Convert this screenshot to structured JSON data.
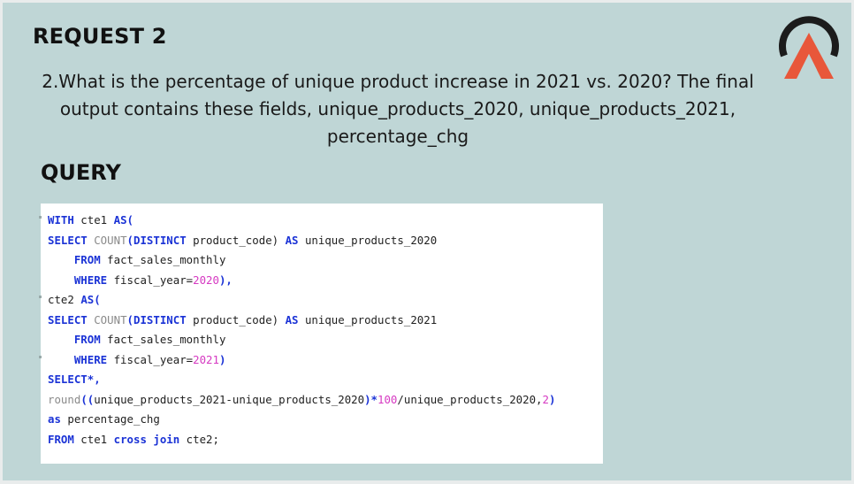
{
  "slide": {
    "title": "REQUEST 2",
    "question": "2.What is the percentage of unique product increase in 2021 vs. 2020? The final output contains these fields, unique_products_2020, unique_products_2021, percentage_chg",
    "query_heading": "QUERY",
    "logo_icon": "triangle-a-logo-icon",
    "colors": {
      "background": "#bfd6d6",
      "logo_dark": "#1c1c1c",
      "logo_accent": "#e8573a",
      "keyword": "#1b33d6",
      "number": "#d63ac2"
    }
  },
  "code": {
    "l1_kw1": "WITH",
    "l1_t1": " cte1 ",
    "l1_kw2": "AS(",
    "l2_kw1": "SELECT",
    "l2_fn": " COUNT",
    "l2_kw2": "(DISTINCT",
    "l2_t1": " product_code) ",
    "l2_kw3": "AS",
    "l2_t2": " unique_products_2020",
    "l3_kw": "    FROM",
    "l3_t": " fact_sales_monthly",
    "l4_kw": "    WHERE",
    "l4_t": " fiscal_year=",
    "l4_num": "2020",
    "l4_kw2": "),",
    "l5_t": "cte2 ",
    "l5_kw": "AS(",
    "l6_kw1": "SELECT",
    "l6_fn": " COUNT",
    "l6_kw2": "(DISTINCT",
    "l6_t1": " product_code) ",
    "l6_kw3": "AS",
    "l6_t2": " unique_products_2021",
    "l7_kw": "    FROM",
    "l7_t": " fact_sales_monthly",
    "l8_kw": "    WHERE",
    "l8_t": " fiscal_year=",
    "l8_num": "2021",
    "l8_kw2": ")",
    "l9_kw": "SELECT*,",
    "l10_fn": "round",
    "l10_kw1": "((",
    "l10_t1": "unique_products_2021-unique_products_2020",
    "l10_kw2": ")*",
    "l10_num1": "100",
    "l10_t2": "/unique_products_2020,",
    "l10_num2": "2",
    "l10_kw3": ")",
    "l11_kw": "as",
    "l11_t": " percentage_chg",
    "l12_kw1": "FROM",
    "l12_t1": " cte1 ",
    "l12_kw2": "cross join",
    "l12_t2": " cte2;"
  }
}
